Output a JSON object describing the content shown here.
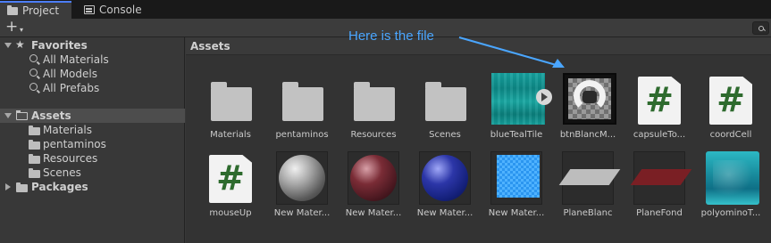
{
  "tabs": [
    {
      "label": "Project",
      "icon": "folder-icon"
    },
    {
      "label": "Console",
      "icon": "console-icon"
    }
  ],
  "toolbar": {
    "add_label": "+",
    "add_caret": "▾"
  },
  "sidebar": {
    "favorites": {
      "label": "Favorites",
      "items": [
        {
          "label": "All Materials",
          "icon": "search-icon"
        },
        {
          "label": "All Models",
          "icon": "search-icon"
        },
        {
          "label": "All Prefabs",
          "icon": "search-icon"
        }
      ]
    },
    "assets": {
      "label": "Assets",
      "items": [
        {
          "label": "Materials",
          "icon": "folder-icon"
        },
        {
          "label": "pentaminos",
          "icon": "folder-icon"
        },
        {
          "label": "Resources",
          "icon": "folder-icon"
        },
        {
          "label": "Scenes",
          "icon": "folder-icon"
        }
      ]
    },
    "packages": {
      "label": "Packages"
    }
  },
  "breadcrumb": "Assets",
  "annotation": "Here is the file",
  "colors": {
    "annotation": "#4aa6ff",
    "accent_tab": "#4c7eff"
  },
  "assets": [
    {
      "label": "Materials",
      "type": "folder"
    },
    {
      "label": "pentaminos",
      "type": "folder"
    },
    {
      "label": "Resources",
      "type": "folder"
    },
    {
      "label": "Scenes",
      "type": "folder"
    },
    {
      "label": "blueTealTile",
      "type": "texture-teal"
    },
    {
      "label": "btnBlancM...",
      "type": "texture-button"
    },
    {
      "label": "capsuleTo...",
      "type": "script"
    },
    {
      "label": "coordCell",
      "type": "script"
    },
    {
      "label": "mouseUp",
      "type": "script"
    },
    {
      "label": "New Mater...",
      "type": "material-grey"
    },
    {
      "label": "New Mater...",
      "type": "material-maroon"
    },
    {
      "label": "New Mater...",
      "type": "material-blue"
    },
    {
      "label": "New Mater...",
      "type": "material-checker"
    },
    {
      "label": "PlaneBlanc",
      "type": "plane-grey"
    },
    {
      "label": "PlaneFond",
      "type": "plane-red"
    },
    {
      "label": "polyominoT...",
      "type": "texture-poly"
    }
  ]
}
